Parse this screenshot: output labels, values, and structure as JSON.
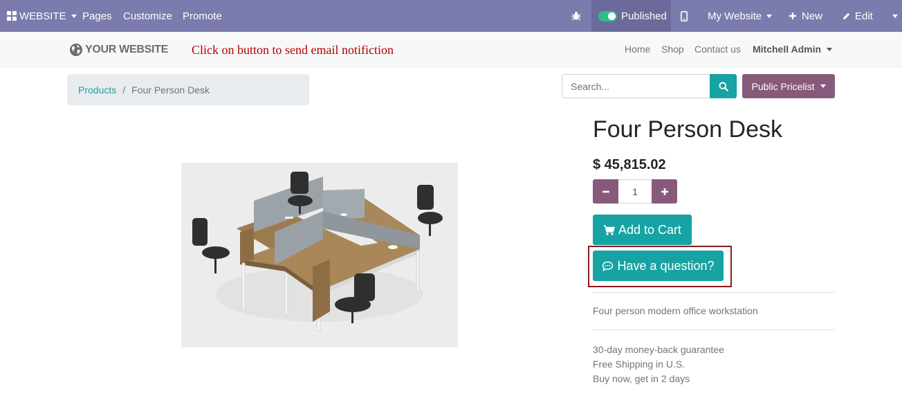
{
  "adminbar": {
    "website_menu": "WEBSITE",
    "pages": "Pages",
    "customize": "Customize",
    "promote": "Promote",
    "published": "Published",
    "my_website": "My Website",
    "new": "New",
    "edit": "Edit",
    "accent_color": "#7c7bad"
  },
  "header": {
    "logo_text": "YOUR WEBSITE",
    "instruction_note": "Click on button to send email notifiction",
    "nav": [
      "Home",
      "Shop",
      "Contact us"
    ],
    "user": "Mitchell Admin"
  },
  "breadcrumb": {
    "parent": "Products",
    "separator": "/",
    "current": "Four Person Desk"
  },
  "search": {
    "placeholder": "Search..."
  },
  "pricelist": {
    "label": "Public Pricelist"
  },
  "product": {
    "title": "Four Person Desk",
    "price": "$ 45,815.02",
    "quantity": "1",
    "add_to_cart": "Add to Cart",
    "ask_question": "Have a question?",
    "description": "Four person modern office workstation",
    "terms": [
      "30-day money-back guarantee",
      "Free Shipping in U.S.",
      "Buy now, get in 2 days"
    ],
    "image_icon": "office-desk-image"
  },
  "colors": {
    "primary": "#875a7b",
    "teal": "#17a2a3",
    "highlight_border": "#8b1a1a",
    "note_red": "#b00000"
  }
}
